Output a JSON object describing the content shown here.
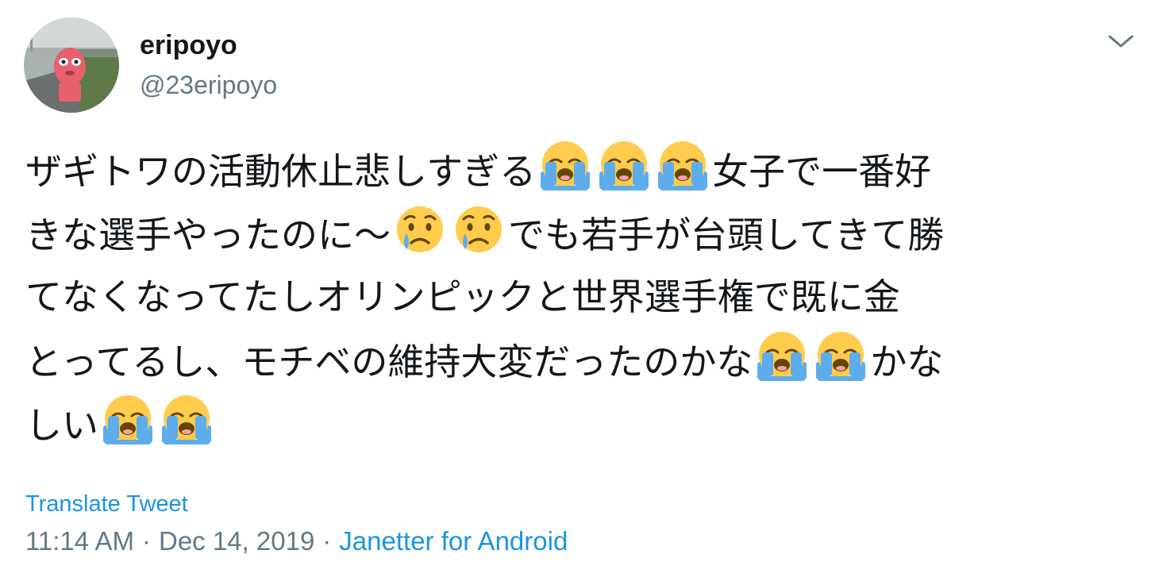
{
  "author": {
    "display_name": "eripoyo",
    "handle": "@23eripoyo"
  },
  "tweet": {
    "lines": [
      [
        "ザギトワの活動休止悲しすぎる",
        "loudly-crying-face",
        "loudly-crying-face",
        "loudly-crying-face",
        "女子で一番好"
      ],
      [
        "きな選手やったのに〜",
        "crying-face",
        "crying-face",
        "でも若手が台頭してきて勝"
      ],
      [
        "てなくなってたしオリンピックと世界選手権で既に金"
      ],
      [
        "とってるし、モチベの維持大変だったのかな",
        "loudly-crying-face",
        "loudly-crying-face",
        "かな"
      ],
      [
        "しい",
        "loudly-crying-face",
        "loudly-crying-face"
      ]
    ]
  },
  "translate_label": "Translate Tweet",
  "time": "11:14 AM",
  "separator": "·",
  "date": "Dec 14, 2019",
  "source": "Janetter for Android",
  "icons": {
    "menu": "chevron-down-icon"
  },
  "colors": {
    "link": "#1b95e0",
    "secondary_text": "#657786",
    "primary_text": "#14171a"
  }
}
